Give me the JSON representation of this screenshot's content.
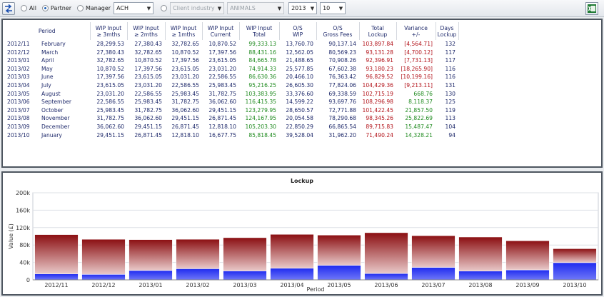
{
  "toolbar": {
    "refresh_icon": "swap-arrows-icon",
    "radios": [
      {
        "label": "All",
        "selected": false,
        "enabled": true
      },
      {
        "label": "Partner",
        "selected": true,
        "enabled": true
      },
      {
        "label": "Manager",
        "selected": false,
        "enabled": true
      },
      {
        "label": "",
        "selected": false,
        "enabled": false
      }
    ],
    "partner_value": "ACH",
    "client_industry_placeholder": "Client industry",
    "industry_value": "ANIMALS",
    "year_value": "2013",
    "count_value": "10",
    "export_icon": "excel-icon"
  },
  "table": {
    "headers": [
      {
        "line1": "Period",
        "line2": ""
      },
      {
        "line1": "WIP Input",
        "line2": "≥ 3mths"
      },
      {
        "line1": "WIP Input",
        "line2": "≥ 2mths"
      },
      {
        "line1": "WIP Input",
        "line2": "≥ 1mths"
      },
      {
        "line1": "WIP Input",
        "line2": "Current"
      },
      {
        "line1": "WIP Input",
        "line2": "Total"
      },
      {
        "line1": "O/S",
        "line2": "WIP"
      },
      {
        "line1": "O/S",
        "line2": "Gross Fees"
      },
      {
        "line1": "Total",
        "line2": "Lockup"
      },
      {
        "line1": "Variance",
        "line2": "+/-"
      },
      {
        "line1": "Days",
        "line2": "Lockup"
      }
    ],
    "rows": [
      {
        "code": "2012/11",
        "month": "February",
        "w3": "28,299.53",
        "w2": "27,380.43",
        "w1": "32,782.65",
        "cur": "10,870.52",
        "total": "99,333.13",
        "oswip": "13,760.70",
        "osfees": "90,137.14",
        "lockup": "103,897.84",
        "variance": "[4,564.71]",
        "var_sign": "neg",
        "days": "132"
      },
      {
        "code": "2012/12",
        "month": "March",
        "w3": "27,380.43",
        "w2": "32,782.65",
        "w1": "10,870.52",
        "cur": "17,397.56",
        "total": "88,431.16",
        "oswip": "12,562.05",
        "osfees": "80,569.23",
        "lockup": "93,131.28",
        "variance": "[4,700.12]",
        "var_sign": "neg",
        "days": "117"
      },
      {
        "code": "2013/01",
        "month": "April",
        "w3": "32,782.65",
        "w2": "10,870.52",
        "w1": "17,397.56",
        "cur": "23,615.05",
        "total": "84,665.78",
        "oswip": "21,488.65",
        "osfees": "70,908.26",
        "lockup": "92,396.91",
        "variance": "[7,731.13]",
        "var_sign": "neg",
        "days": "117"
      },
      {
        "code": "2013/02",
        "month": "May",
        "w3": "10,870.52",
        "w2": "17,397.56",
        "w1": "23,615.05",
        "cur": "23,031.20",
        "total": "74,914.33",
        "oswip": "25,577.85",
        "osfees": "67,602.38",
        "lockup": "93,180.23",
        "variance": "[18,265.90]",
        "var_sign": "neg",
        "days": "116"
      },
      {
        "code": "2013/03",
        "month": "June",
        "w3": "17,397.56",
        "w2": "23,615.05",
        "w1": "23,031.20",
        "cur": "22,586.55",
        "total": "86,630.36",
        "oswip": "20,466.10",
        "osfees": "76,363.42",
        "lockup": "96,829.52",
        "variance": "[10,199.16]",
        "var_sign": "neg",
        "days": "116"
      },
      {
        "code": "2013/04",
        "month": "July",
        "w3": "23,615.05",
        "w2": "23,031.20",
        "w1": "22,586.55",
        "cur": "25,983.45",
        "total": "95,216.25",
        "oswip": "26,605.30",
        "osfees": "77,824.06",
        "lockup": "104,429.36",
        "variance": "[9,213.11]",
        "var_sign": "neg",
        "days": "131"
      },
      {
        "code": "2013/05",
        "month": "August",
        "w3": "23,031.20",
        "w2": "22,586.55",
        "w1": "25,983.45",
        "cur": "31,782.75",
        "total": "103,383.95",
        "oswip": "33,376.60",
        "osfees": "69,338.59",
        "lockup": "102,715.19",
        "variance": "668.76",
        "var_sign": "pos",
        "days": "130"
      },
      {
        "code": "2013/06",
        "month": "September",
        "w3": "22,586.55",
        "w2": "25,983.45",
        "w1": "31,782.75",
        "cur": "36,062.60",
        "total": "116,415.35",
        "oswip": "14,599.22",
        "osfees": "93,697.76",
        "lockup": "108,296.98",
        "variance": "8,118.37",
        "var_sign": "pos",
        "days": "125"
      },
      {
        "code": "2013/07",
        "month": "October",
        "w3": "25,983.45",
        "w2": "31,782.75",
        "w1": "36,062.60",
        "cur": "29,451.15",
        "total": "123,279.95",
        "oswip": "28,650.57",
        "osfees": "72,771.88",
        "lockup": "101,422.45",
        "variance": "21,857.50",
        "var_sign": "pos",
        "days": "119"
      },
      {
        "code": "2013/08",
        "month": "November",
        "w3": "31,782.75",
        "w2": "36,062.60",
        "w1": "29,451.15",
        "cur": "26,871.45",
        "total": "124,167.95",
        "oswip": "20,054.58",
        "osfees": "78,290.68",
        "lockup": "98,345.26",
        "variance": "25,822.69",
        "var_sign": "pos",
        "days": "113"
      },
      {
        "code": "2013/09",
        "month": "December",
        "w3": "36,062.60",
        "w2": "29,451.15",
        "w1": "26,871.45",
        "cur": "12,818.10",
        "total": "105,203.30",
        "oswip": "22,850.29",
        "osfees": "66,865.54",
        "lockup": "89,715.83",
        "variance": "15,487.47",
        "var_sign": "pos",
        "days": "104"
      },
      {
        "code": "2013/10",
        "month": "January",
        "w3": "29,451.15",
        "w2": "26,871.45",
        "w1": "12,818.10",
        "cur": "16,677.75",
        "total": "85,818.45",
        "oswip": "39,528.04",
        "osfees": "31,962.20",
        "lockup": "71,490.24",
        "variance": "14,328.21",
        "var_sign": "pos",
        "days": "94"
      }
    ]
  },
  "chart_data": {
    "type": "bar",
    "stacked": true,
    "title": "Lockup",
    "xlabel": "Period",
    "ylabel": "Value (£)",
    "ylim": [
      0,
      200000
    ],
    "yticks": [
      "0",
      "40k",
      "80k",
      "120k",
      "160k",
      "200k"
    ],
    "ytick_values": [
      0,
      40000,
      80000,
      120000,
      160000,
      200000
    ],
    "categories": [
      "2012/11",
      "2012/12",
      "2013/01",
      "2013/02",
      "2013/03",
      "2013/04",
      "2013/05",
      "2013/06",
      "2013/07",
      "2013/08",
      "2013/09",
      "2013/10"
    ],
    "series": [
      {
        "values": [
          13760.7,
          12562.05,
          21488.65,
          25577.85,
          20466.1,
          26605.3,
          33376.6,
          14599.22,
          28650.57,
          20054.58,
          22850.29,
          39528.04
        ],
        "color": "#1f2bf0"
      },
      {
        "values": [
          90137.14,
          80569.23,
          70908.26,
          67602.38,
          76363.42,
          77824.06,
          69338.59,
          93697.76,
          72771.88,
          78290.68,
          66865.54,
          31962.2
        ],
        "color": "#8b0f12"
      }
    ],
    "grid": true,
    "legend": "none"
  }
}
